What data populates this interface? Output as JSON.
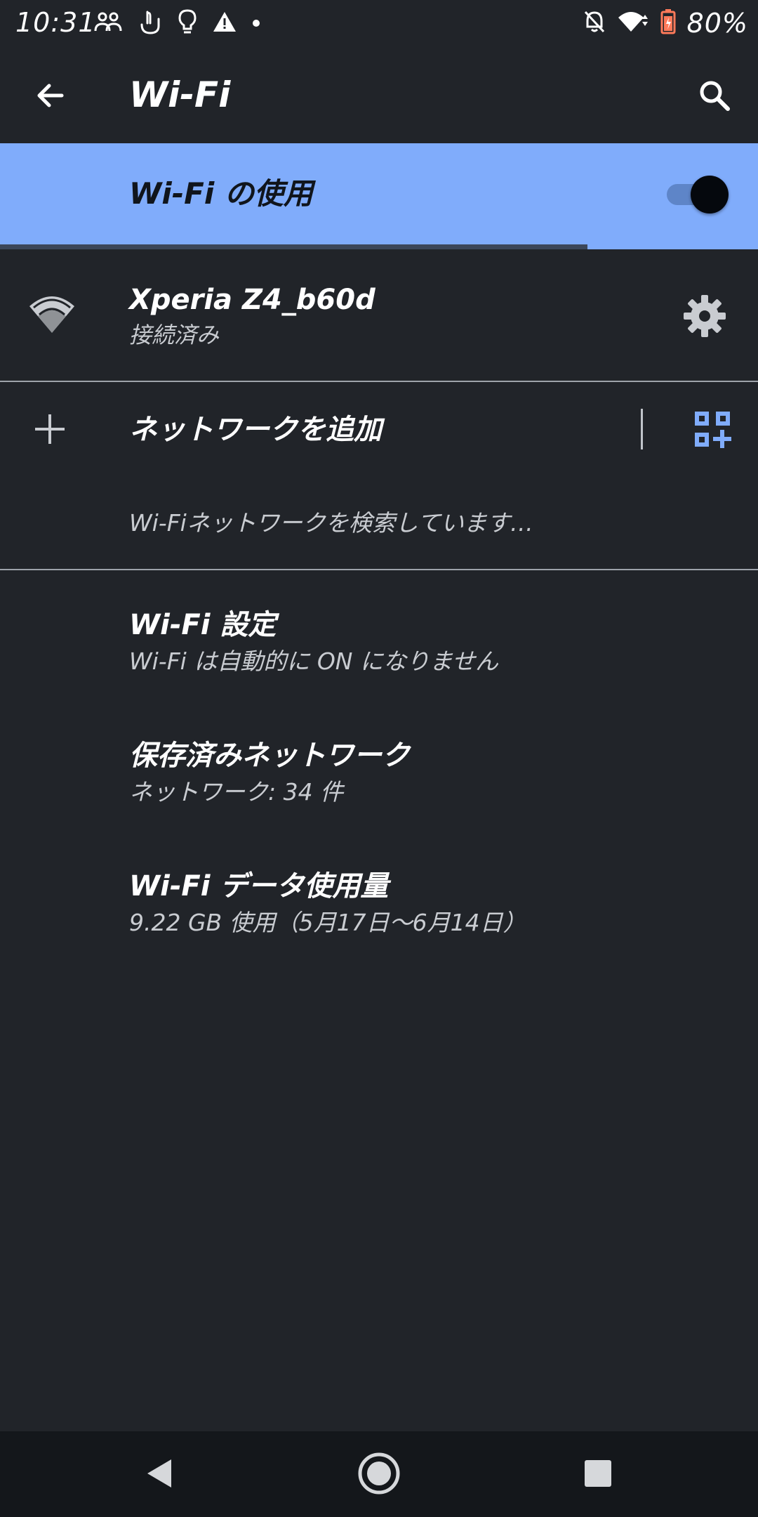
{
  "status_bar": {
    "time": "10:31",
    "battery_percent": "80%",
    "left_icons": [
      "people-icon",
      "hand-icon",
      "lightbulb-icon",
      "warning-icon",
      "dot-icon"
    ],
    "right_icons": [
      "notifications-off-icon",
      "wifi-icon",
      "battery-icon"
    ]
  },
  "app_bar": {
    "title": "Wi-Fi",
    "back_icon": "arrow-back-icon",
    "search_icon": "search-icon"
  },
  "master_switch": {
    "label": "Wi-Fi の使用",
    "enabled": true,
    "accent_color": "#80acfb"
  },
  "scan_progress": 0.775,
  "connected_network": {
    "name": "Xperia Z4_b60d",
    "status": "接続済み",
    "icon": "wifi-signal-icon",
    "settings_icon": "gear-icon"
  },
  "add_network": {
    "label": "ネットワークを追加",
    "icon": "plus-icon",
    "qr_icon": "qr-code-icon"
  },
  "searching_text": "Wi-Fiネットワークを検索しています…",
  "preferences": [
    {
      "title": "Wi-Fi 設定",
      "summary": "Wi-Fi は自動的に ON になりません"
    },
    {
      "title": "保存済みネットワーク",
      "summary": "ネットワーク: 34 件"
    },
    {
      "title": "Wi-Fi データ使用量",
      "summary": "9.22 GB 使用（5月17日～6月14日）"
    }
  ],
  "nav_bar": {
    "back": "nav-back-icon",
    "home": "nav-home-icon",
    "recents": "nav-recents-icon"
  },
  "colors": {
    "background": "#212429",
    "accent": "#80acfb",
    "navbar": "#14171b"
  }
}
